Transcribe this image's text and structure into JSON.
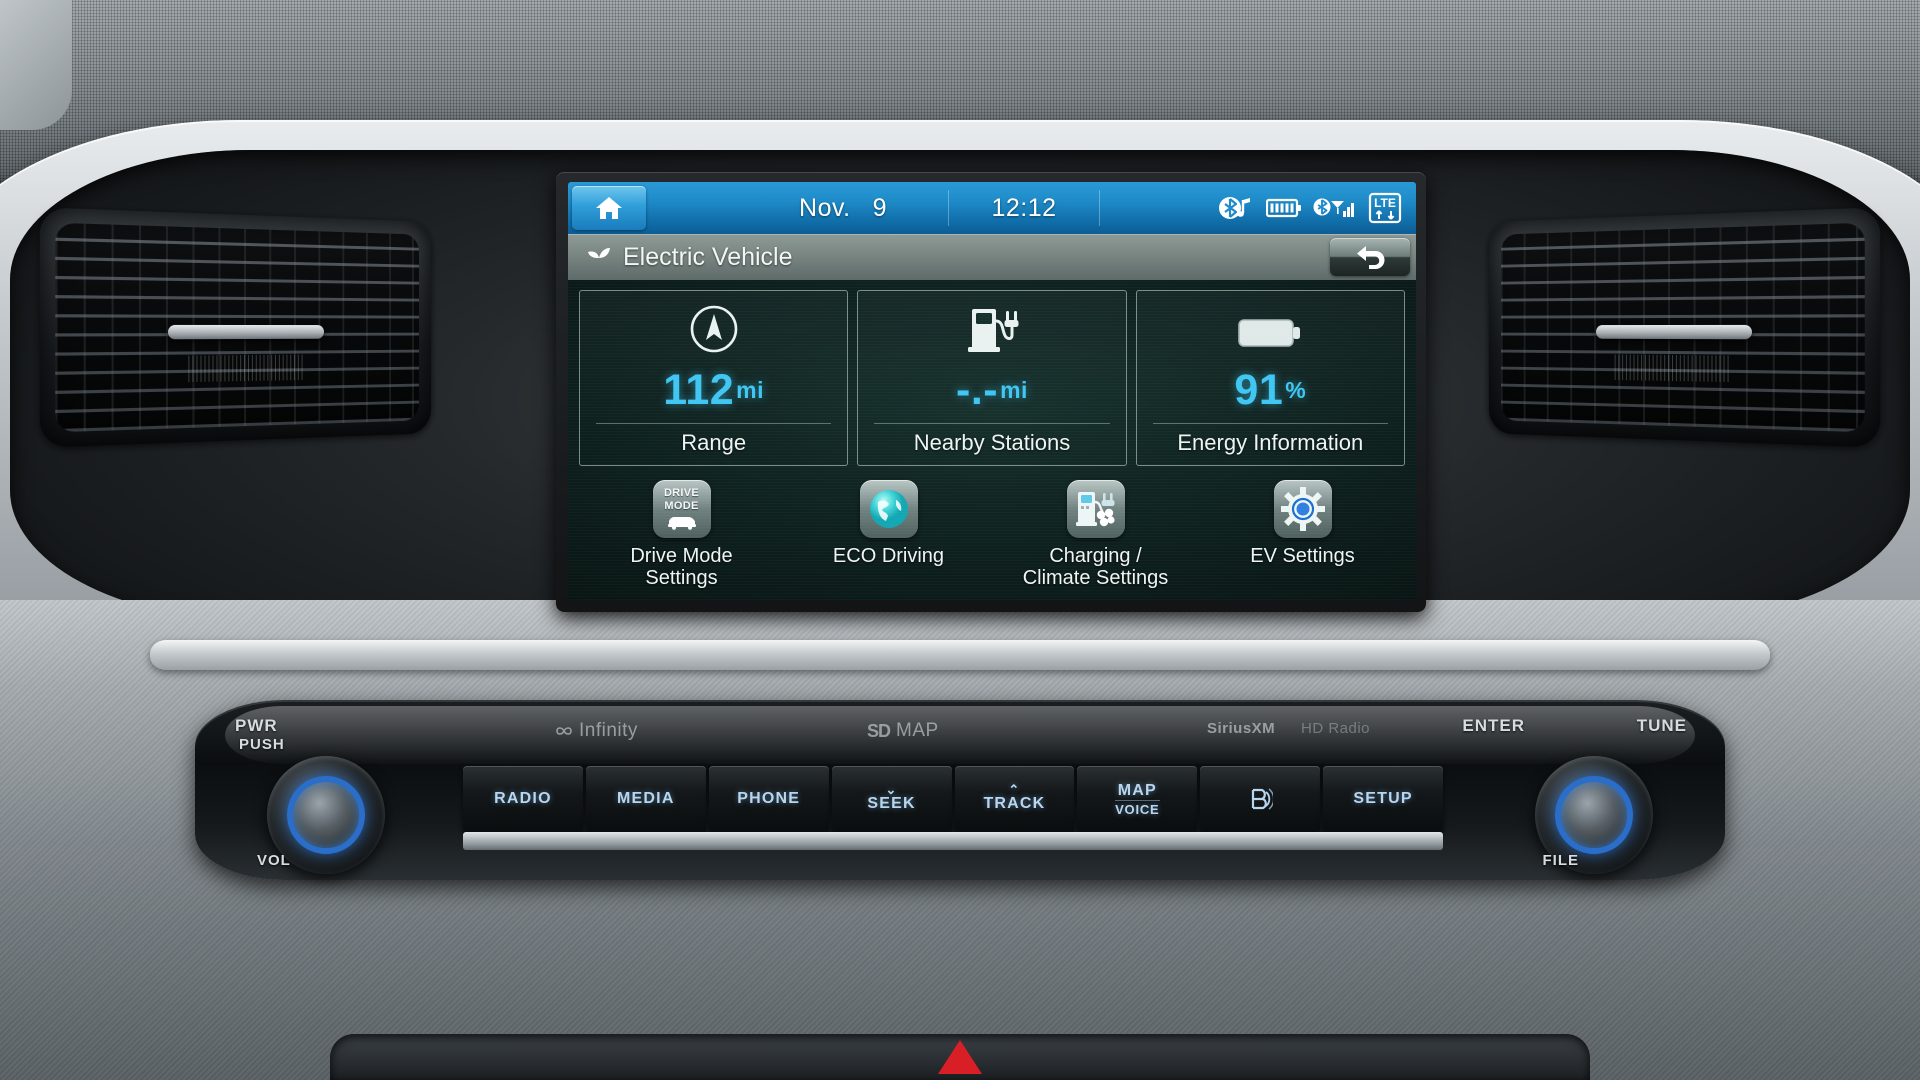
{
  "screen": {
    "status_bar": {
      "home_icon": "home-icon",
      "date": "Nov.",
      "day": "9",
      "time": "12:12",
      "icons": [
        "bluetooth-audio-icon",
        "battery-icon",
        "bluetooth-signal-icon",
        "lte-icon"
      ],
      "lte_label": "LTE"
    },
    "title_bar": {
      "leaf_icon": "leaf-icon",
      "title": "Electric Vehicle",
      "back_icon": "back-arrow-icon"
    },
    "tiles": [
      {
        "icon": "compass-range-icon",
        "value": "112",
        "unit": "mi",
        "label": "Range"
      },
      {
        "icon": "charging-station-icon",
        "value": "-.-",
        "unit": "mi",
        "label": "Nearby Stations"
      },
      {
        "icon": "battery-horizontal-icon",
        "value": "91",
        "unit": "%",
        "label": "Energy Information"
      }
    ],
    "shortcuts": [
      {
        "icon": "drive-mode-icon",
        "icon_text_1": "DRIVE",
        "icon_text_2": "MODE",
        "label_1": "Drive Mode",
        "label_2": "Settings"
      },
      {
        "icon": "eco-globe-icon",
        "label_1": "ECO Driving",
        "label_2": ""
      },
      {
        "icon": "charging-climate-icon",
        "label_1": "Charging /",
        "label_2": "Climate Settings"
      },
      {
        "icon": "gear-icon",
        "label_1": "EV Settings",
        "label_2": ""
      }
    ],
    "colors": {
      "accent_cyan": "#3fc6f2",
      "status_blue": "#1f8cc9",
      "screen_bg": "#0d1f1d"
    }
  },
  "console": {
    "brands": {
      "infinity": "Infinity",
      "sd_map": "MAP",
      "sd_label": "SD",
      "siriusxm": "SiriusXM",
      "hd_radio": "HD Radio"
    },
    "buttons": [
      {
        "label": "RADIO",
        "sub": "",
        "chev": ""
      },
      {
        "label": "MEDIA",
        "sub": "",
        "chev": ""
      },
      {
        "label": "PHONE",
        "sub": "",
        "chev": ""
      },
      {
        "label": "SEEK",
        "sub": "",
        "chev": "⌄"
      },
      {
        "label": "TRACK",
        "sub": "",
        "chev": "⌃"
      },
      {
        "label": "MAP",
        "sub": "VOICE",
        "chev": ""
      },
      {
        "label": "",
        "sub": "",
        "chev": "",
        "icon": "blue-link-icon"
      },
      {
        "label": "SETUP",
        "sub": "",
        "chev": ""
      }
    ],
    "left_knob": {
      "top_label": "PWR",
      "push_label": "PUSH",
      "bottom_label": "VOL"
    },
    "right_knob": {
      "left_label": "ENTER",
      "top_label": "TUNE",
      "bottom_label": "FILE"
    }
  }
}
